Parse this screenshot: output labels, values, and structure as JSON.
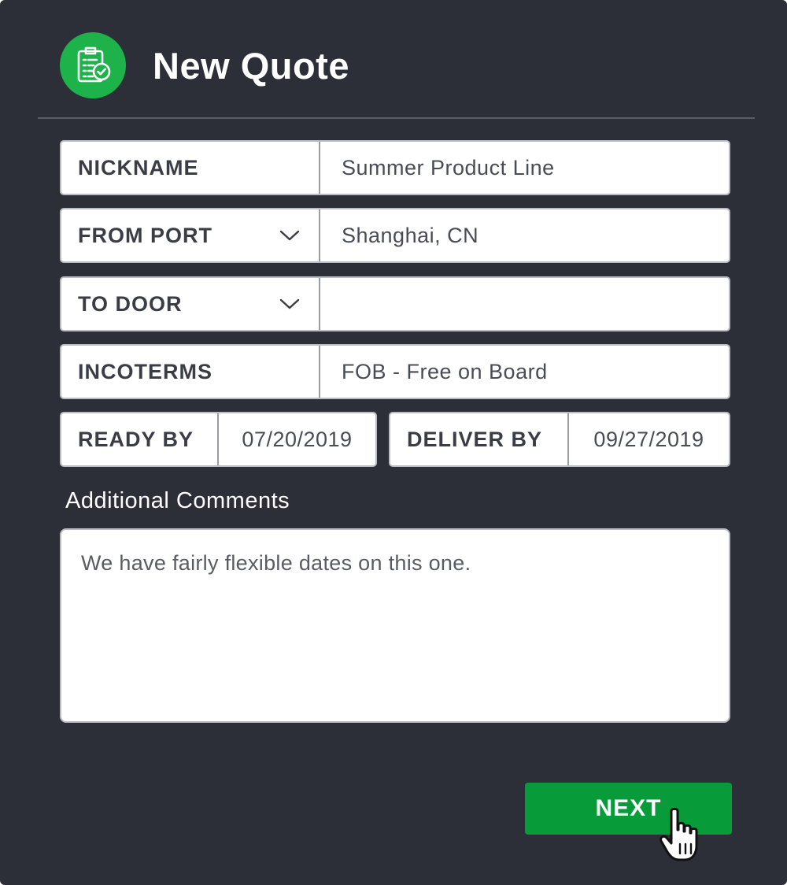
{
  "header": {
    "title": "New Quote",
    "icon": "clipboard-check-icon",
    "accent_color": "#1db34a"
  },
  "form": {
    "nickname": {
      "label": "NICKNAME",
      "value": "Summer Product Line"
    },
    "from_port": {
      "label": "FROM PORT",
      "value": "Shanghai, CN"
    },
    "to_door": {
      "label": "TO DOOR",
      "value": ""
    },
    "incoterms": {
      "label": "INCOTERMS",
      "value": "FOB - Free on Board"
    },
    "ready_by": {
      "label": "READY BY",
      "value": "07/20/2019"
    },
    "deliver_by": {
      "label": "DELIVER BY",
      "value": "09/27/2019"
    }
  },
  "comments": {
    "label": "Additional Comments",
    "value": "We have fairly flexible dates on this one."
  },
  "actions": {
    "next_label": "NEXT",
    "next_color": "#079b3a"
  },
  "colors": {
    "panel_bg": "#2c2e38"
  }
}
